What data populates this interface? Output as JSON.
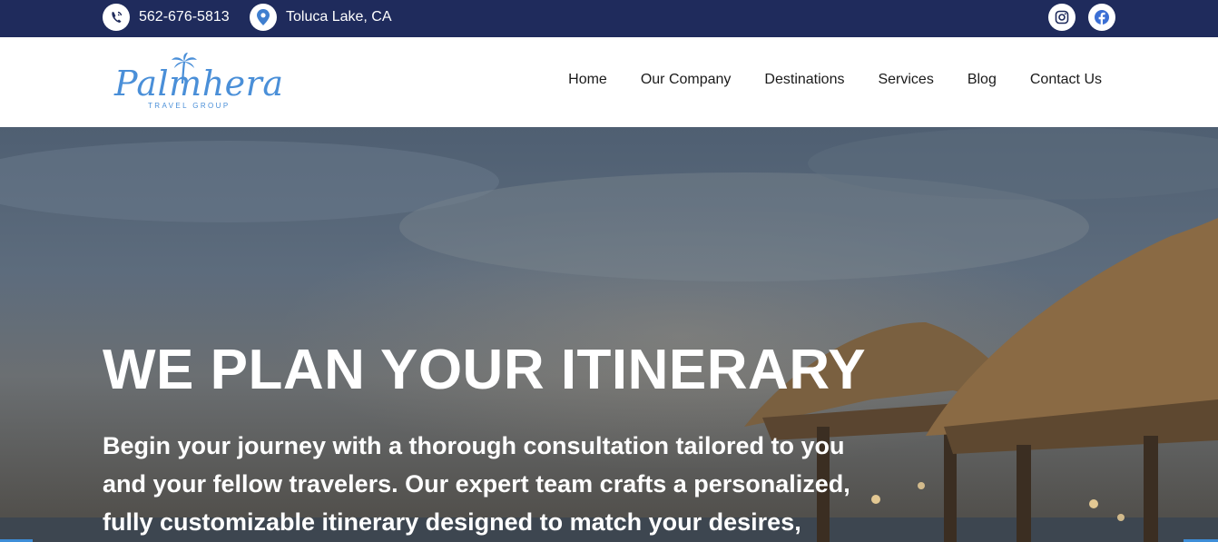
{
  "topbar": {
    "phone": "562-676-5813",
    "location": "Toluca Lake, CA",
    "icons": {
      "phone": "phone-icon",
      "location": "map-pin-icon",
      "instagram": "instagram-icon",
      "facebook": "facebook-icon"
    }
  },
  "header": {
    "logo_text": "Palmhera",
    "logo_subtext": "TRAVEL GROUP",
    "nav": [
      {
        "label": "Home"
      },
      {
        "label": "Our Company"
      },
      {
        "label": "Destinations"
      },
      {
        "label": "Services"
      },
      {
        "label": "Blog"
      },
      {
        "label": "Contact Us"
      }
    ]
  },
  "hero": {
    "title": "WE PLAN YOUR ITINERARY",
    "text": "Begin your journey with a thorough consultation tailored to you and your fellow travelers. Our expert team crafts a personalized, fully customizable itinerary designed to match your desires,"
  },
  "colors": {
    "topbar_bg": "#1f2b5c",
    "brand_blue": "#4a8fd8",
    "nav_text": "#1a1a1a"
  }
}
